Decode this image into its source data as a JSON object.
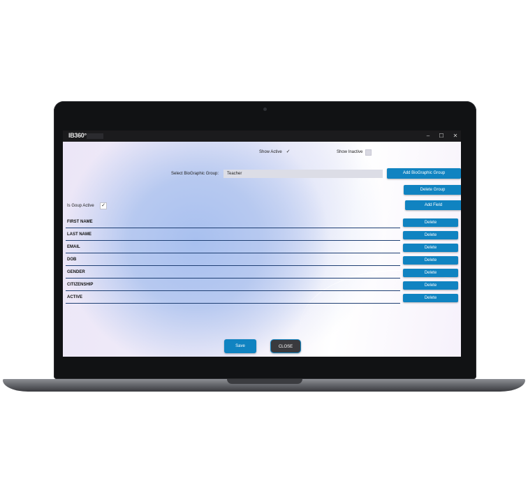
{
  "window": {
    "logo": "IB360°",
    "controls": {
      "minimize": "–",
      "maximize": "☐",
      "close": "✕"
    }
  },
  "filters": {
    "show_active_label": "Show Active",
    "show_active_checked": true,
    "show_inactive_label": "Show Inactive",
    "show_inactive_checked": false
  },
  "group": {
    "select_label": "Select BioGraphic Group:",
    "selected_value": "Teacher",
    "add_group_label": "Add BioGraphic Group",
    "delete_group_label": "Delete Group",
    "is_active_label": "Is Goup Active",
    "is_active_checked": true,
    "add_field_label": "Add Field"
  },
  "fields": [
    {
      "name": "FIRST NAME",
      "delete_label": "Delete"
    },
    {
      "name": "LAST NAME",
      "delete_label": "Delete"
    },
    {
      "name": "EMAIL",
      "delete_label": "Delete"
    },
    {
      "name": "DOB",
      "delete_label": "Delete"
    },
    {
      "name": "GENDER",
      "delete_label": "Delete"
    },
    {
      "name": "CITIZENSHIP",
      "delete_label": "Delete"
    },
    {
      "name": "ACTIVE",
      "delete_label": "Delete"
    }
  ],
  "footer": {
    "save_label": "Save",
    "close_label": "CLOSE"
  },
  "colors": {
    "accent": "#1083c1",
    "row_line": "#1f3f73",
    "titlebar": "#1b1b1d"
  }
}
